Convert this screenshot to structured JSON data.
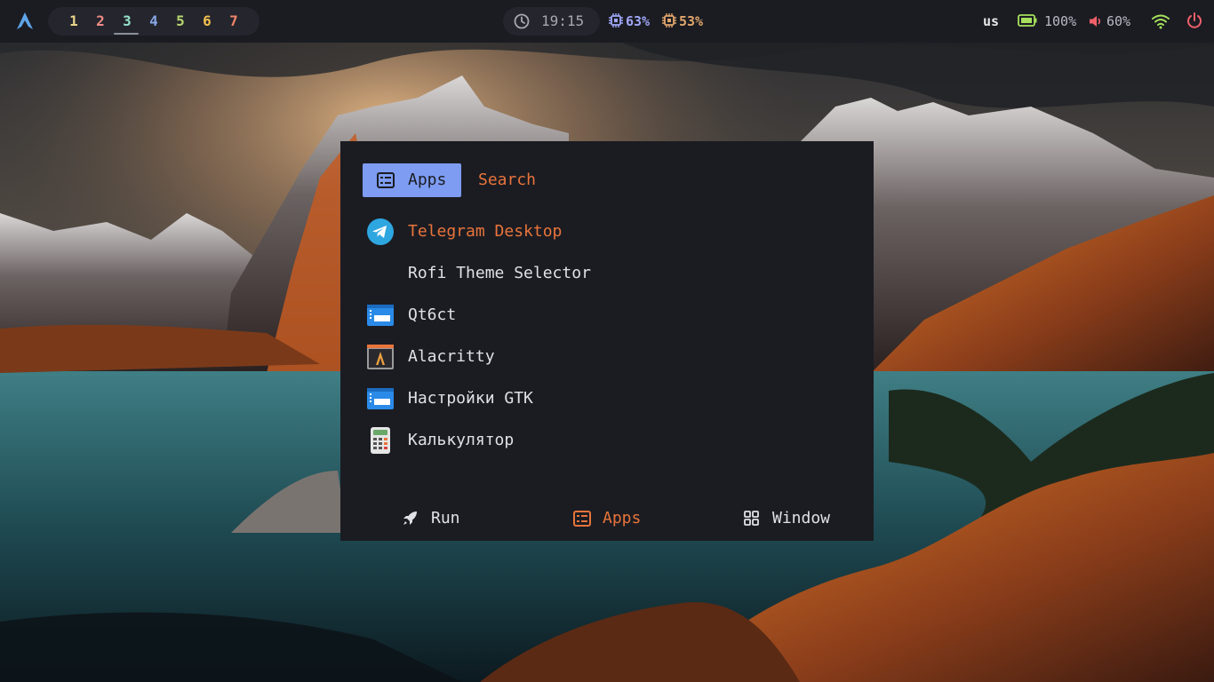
{
  "topbar": {
    "workspaces": [
      {
        "label": "1",
        "color": "#e7d48a"
      },
      {
        "label": "2",
        "color": "#f08b86"
      },
      {
        "label": "3",
        "color": "#94e0c8"
      },
      {
        "label": "4",
        "color": "#86a7e6"
      },
      {
        "label": "5",
        "color": "#b8d66f"
      },
      {
        "label": "6",
        "color": "#f2c14e"
      },
      {
        "label": "7",
        "color": "#f0846b"
      }
    ],
    "active_workspace": "3",
    "clock": "19:15",
    "cpu": "63%",
    "memory": "53%",
    "keyboard_layout": "us",
    "battery": "100%",
    "volume": "60%",
    "icons": {
      "logo": "arch-linux-icon",
      "clock": "clock-icon",
      "cpu": "cpu-icon",
      "memory": "memory-chip-icon",
      "battery": "battery-icon",
      "volume": "speaker-icon",
      "wifi": "wifi-icon",
      "power": "power-icon"
    }
  },
  "launcher": {
    "tabs": {
      "apps": "Apps",
      "search": "Search"
    },
    "items": [
      {
        "label": "Telegram Desktop",
        "icon": "telegram-icon",
        "selected": true
      },
      {
        "label": "Rofi Theme Selector",
        "icon": "none",
        "selected": false
      },
      {
        "label": "Qt6ct",
        "icon": "settings-window-icon",
        "selected": false
      },
      {
        "label": "Alacritty",
        "icon": "alacritty-icon",
        "selected": false
      },
      {
        "label": "Настройки GTK",
        "icon": "settings-window-icon",
        "selected": false
      },
      {
        "label": "Калькулятор",
        "icon": "calculator-icon",
        "selected": false
      }
    ],
    "modes": {
      "run": "Run",
      "apps": "Apps",
      "window": "Window"
    }
  },
  "colors": {
    "accent": "#e8743b",
    "active_tab_bg": "#7d9cf2",
    "panel_bg": "#1b1c22",
    "text": "#dfe1e6"
  }
}
